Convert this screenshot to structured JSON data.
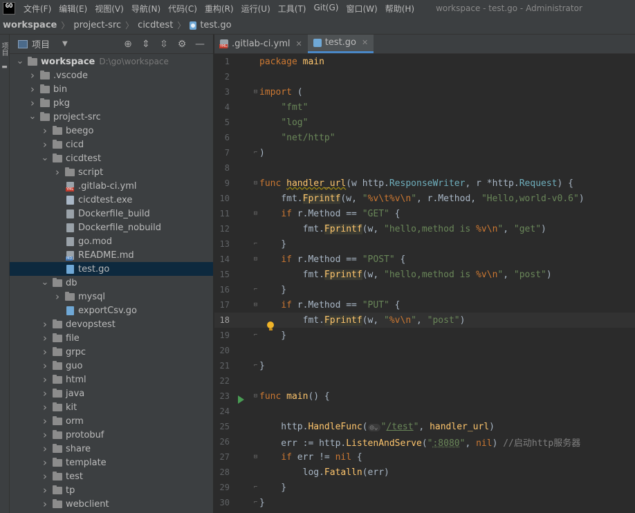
{
  "menu": {
    "items": [
      "文件(F)",
      "编辑(E)",
      "视图(V)",
      "导航(N)",
      "代码(C)",
      "重构(R)",
      "运行(U)",
      "工具(T)",
      "Git(G)",
      "窗口(W)",
      "帮助(H)"
    ],
    "window_title": "workspace - test.go - Administrator",
    "logo_text": "GO"
  },
  "breadcrumbs": [
    "workspace",
    "project-src",
    "cicdtest",
    "test.go"
  ],
  "strip": {
    "project_tab": "项目"
  },
  "project_panel": {
    "title": "项目",
    "tree": [
      {
        "label": "workspace",
        "hint": "D:\\go\\workspace",
        "type": "folder",
        "depth": 0,
        "expanded": true,
        "bold": true
      },
      {
        "label": ".vscode",
        "type": "folder",
        "depth": 1,
        "expanded": false
      },
      {
        "label": "bin",
        "type": "folder",
        "depth": 1,
        "expanded": false
      },
      {
        "label": "pkg",
        "type": "folder",
        "depth": 1,
        "expanded": false
      },
      {
        "label": "project-src",
        "type": "folder",
        "depth": 1,
        "expanded": true
      },
      {
        "label": "beego",
        "type": "folder",
        "depth": 2,
        "expanded": false
      },
      {
        "label": "cicd",
        "type": "folder",
        "depth": 2,
        "expanded": false
      },
      {
        "label": "cicdtest",
        "type": "folder",
        "depth": 2,
        "expanded": true
      },
      {
        "label": "script",
        "type": "folder",
        "depth": 3,
        "expanded": false
      },
      {
        "label": ".gitlab-ci.yml",
        "type": "yml",
        "depth": 3
      },
      {
        "label": "cicdtest.exe",
        "type": "exe",
        "depth": 3
      },
      {
        "label": "Dockerfile_build",
        "type": "file",
        "depth": 3
      },
      {
        "label": "Dockerfile_nobuild",
        "type": "file",
        "depth": 3
      },
      {
        "label": "go.mod",
        "type": "file",
        "depth": 3
      },
      {
        "label": "README.md",
        "type": "md",
        "depth": 3
      },
      {
        "label": "test.go",
        "type": "go",
        "depth": 3,
        "selected": true
      },
      {
        "label": "db",
        "type": "folder",
        "depth": 2,
        "expanded": true
      },
      {
        "label": "mysql",
        "type": "folder",
        "depth": 3,
        "expanded": false
      },
      {
        "label": "exportCsv.go",
        "type": "go",
        "depth": 3
      },
      {
        "label": "devopstest",
        "type": "folder",
        "depth": 2,
        "expanded": false
      },
      {
        "label": "file",
        "type": "folder",
        "depth": 2,
        "expanded": false
      },
      {
        "label": "grpc",
        "type": "folder",
        "depth": 2,
        "expanded": false
      },
      {
        "label": "guo",
        "type": "folder",
        "depth": 2,
        "expanded": false
      },
      {
        "label": "html",
        "type": "folder",
        "depth": 2,
        "expanded": false
      },
      {
        "label": "java",
        "type": "folder",
        "depth": 2,
        "expanded": false
      },
      {
        "label": "kit",
        "type": "folder",
        "depth": 2,
        "expanded": false
      },
      {
        "label": "orm",
        "type": "folder",
        "depth": 2,
        "expanded": false
      },
      {
        "label": "protobuf",
        "type": "folder",
        "depth": 2,
        "expanded": false
      },
      {
        "label": "share",
        "type": "folder",
        "depth": 2,
        "expanded": false
      },
      {
        "label": "template",
        "type": "folder",
        "depth": 2,
        "expanded": false
      },
      {
        "label": "test",
        "type": "folder",
        "depth": 2,
        "expanded": false
      },
      {
        "label": "tp",
        "type": "folder",
        "depth": 2,
        "expanded": false
      },
      {
        "label": "webclient",
        "type": "folder",
        "depth": 2,
        "expanded": false
      }
    ]
  },
  "editor": {
    "tabs": [
      {
        "label": ".gitlab-ci.yml",
        "icon": "yml",
        "active": false
      },
      {
        "label": "test.go",
        "icon": "go",
        "active": true
      }
    ],
    "current_line": 18,
    "lines": [
      {
        "n": 1,
        "tokens": [
          [
            "kw",
            "package"
          ],
          [
            "def",
            " "
          ],
          [
            "fn",
            "main"
          ]
        ]
      },
      {
        "n": 2,
        "tokens": []
      },
      {
        "n": 3,
        "fold": "open",
        "tokens": [
          [
            "kw",
            "import"
          ],
          [
            "def",
            " ("
          ]
        ]
      },
      {
        "n": 4,
        "tokens": [
          [
            "def",
            "    "
          ],
          [
            "str",
            "\"fmt\""
          ]
        ]
      },
      {
        "n": 5,
        "tokens": [
          [
            "def",
            "    "
          ],
          [
            "str",
            "\"log\""
          ]
        ]
      },
      {
        "n": 6,
        "tokens": [
          [
            "def",
            "    "
          ],
          [
            "str",
            "\"net/http\""
          ]
        ]
      },
      {
        "n": 7,
        "fold": "close",
        "tokens": [
          [
            "def",
            ")"
          ]
        ]
      },
      {
        "n": 8,
        "tokens": []
      },
      {
        "n": 9,
        "fold": "open",
        "tokens": [
          [
            "kw",
            "func"
          ],
          [
            "def",
            " "
          ],
          [
            "fn squiggle",
            "handler_url"
          ],
          [
            "def",
            "(w "
          ],
          [
            "def",
            "http."
          ],
          [
            "typ",
            "ResponseWriter"
          ],
          [
            "def",
            ", r *"
          ],
          [
            "def",
            "http."
          ],
          [
            "typ",
            "Request"
          ],
          [
            "def",
            ") {"
          ]
        ]
      },
      {
        "n": 10,
        "tokens": [
          [
            "def",
            "    fmt."
          ],
          [
            "fn hl",
            "Fprintf"
          ],
          [
            "def",
            "(w, "
          ],
          [
            "str",
            "\""
          ],
          [
            "fmt-esc",
            "%v\\t%v\\n"
          ],
          [
            "str",
            "\""
          ],
          [
            "def",
            ", r.Method, "
          ],
          [
            "str",
            "\"Hello,world-v0.6\""
          ],
          [
            "def",
            ")"
          ]
        ]
      },
      {
        "n": 11,
        "fold": "open",
        "tokens": [
          [
            "def",
            "    "
          ],
          [
            "kw",
            "if"
          ],
          [
            "def",
            " r.Method == "
          ],
          [
            "str",
            "\"GET\""
          ],
          [
            "def",
            " {"
          ]
        ]
      },
      {
        "n": 12,
        "tokens": [
          [
            "def",
            "        fmt."
          ],
          [
            "fn hl",
            "Fprintf"
          ],
          [
            "def",
            "(w, "
          ],
          [
            "str",
            "\"hello,method is "
          ],
          [
            "fmt-esc",
            "%v\\n"
          ],
          [
            "str",
            "\""
          ],
          [
            "def",
            ", "
          ],
          [
            "str",
            "\"get\""
          ],
          [
            "def",
            ")"
          ]
        ]
      },
      {
        "n": 13,
        "fold": "close",
        "tokens": [
          [
            "def",
            "    }"
          ]
        ]
      },
      {
        "n": 14,
        "fold": "open",
        "tokens": [
          [
            "def",
            "    "
          ],
          [
            "kw",
            "if"
          ],
          [
            "def",
            " r.Method == "
          ],
          [
            "str",
            "\"POST\""
          ],
          [
            "def",
            " {"
          ]
        ]
      },
      {
        "n": 15,
        "tokens": [
          [
            "def",
            "        fmt."
          ],
          [
            "fn hl",
            "Fprintf"
          ],
          [
            "def",
            "(w, "
          ],
          [
            "str",
            "\"hello,method is "
          ],
          [
            "fmt-esc",
            "%v\\n"
          ],
          [
            "str",
            "\""
          ],
          [
            "def",
            ", "
          ],
          [
            "str",
            "\"post\""
          ],
          [
            "def",
            ")"
          ]
        ]
      },
      {
        "n": 16,
        "fold": "close",
        "tokens": [
          [
            "def",
            "    }"
          ]
        ]
      },
      {
        "n": 17,
        "fold": "open",
        "tokens": [
          [
            "def",
            "    "
          ],
          [
            "kw",
            "if"
          ],
          [
            "def",
            " r.Method == "
          ],
          [
            "str",
            "\"PUT\""
          ],
          [
            "def",
            " {"
          ]
        ]
      },
      {
        "n": 18,
        "bulb": true,
        "tokens": [
          [
            "def",
            "        fmt."
          ],
          [
            "fn hl",
            "Fprintf"
          ],
          [
            "def",
            "(w, "
          ],
          [
            "str",
            "\""
          ],
          [
            "fmt-esc",
            "%v\\n"
          ],
          [
            "str",
            "\""
          ],
          [
            "def",
            ", "
          ],
          [
            "str",
            "\"post\""
          ],
          [
            "def",
            ")"
          ]
        ]
      },
      {
        "n": 19,
        "fold": "close",
        "tokens": [
          [
            "def",
            "    }"
          ]
        ]
      },
      {
        "n": 20,
        "tokens": []
      },
      {
        "n": 21,
        "fold": "close",
        "tokens": [
          [
            "def",
            "}"
          ]
        ]
      },
      {
        "n": 22,
        "tokens": []
      },
      {
        "n": 23,
        "run": true,
        "fold": "open",
        "tokens": [
          [
            "kw",
            "func"
          ],
          [
            "def",
            " "
          ],
          [
            "fn",
            "main"
          ],
          [
            "def",
            "() {"
          ]
        ]
      },
      {
        "n": 24,
        "tokens": []
      },
      {
        "n": 25,
        "tokens": [
          [
            "def",
            "    http."
          ],
          [
            "fn",
            "HandleFunc"
          ],
          [
            "def",
            "("
          ],
          [
            "inlay",
            "◎⌄"
          ],
          [
            "str",
            "\""
          ],
          [
            "url",
            "/test"
          ],
          [
            "str",
            "\""
          ],
          [
            "def",
            ", "
          ],
          [
            "fn",
            "handler_url"
          ],
          [
            "def",
            ")"
          ]
        ]
      },
      {
        "n": 26,
        "tokens": [
          [
            "def",
            "    err := "
          ],
          [
            "def",
            "http."
          ],
          [
            "fn",
            "ListenAndServe"
          ],
          [
            "def",
            "("
          ],
          [
            "str",
            "\""
          ],
          [
            "port",
            ":8080"
          ],
          [
            "str",
            "\""
          ],
          [
            "def",
            ", "
          ],
          [
            "nil",
            "nil"
          ],
          [
            "def",
            ") "
          ],
          [
            "cm",
            "//启动http服务器"
          ]
        ]
      },
      {
        "n": 27,
        "fold": "open",
        "tokens": [
          [
            "def",
            "    "
          ],
          [
            "kw",
            "if"
          ],
          [
            "def",
            " err != "
          ],
          [
            "nil",
            "nil"
          ],
          [
            "def",
            " {"
          ]
        ]
      },
      {
        "n": 28,
        "tokens": [
          [
            "def",
            "        log."
          ],
          [
            "fn",
            "Fatalln"
          ],
          [
            "def",
            "(err)"
          ]
        ]
      },
      {
        "n": 29,
        "fold": "close",
        "tokens": [
          [
            "def",
            "    }"
          ]
        ]
      },
      {
        "n": 30,
        "fold": "close",
        "tokens": [
          [
            "def",
            "}"
          ]
        ]
      }
    ]
  }
}
